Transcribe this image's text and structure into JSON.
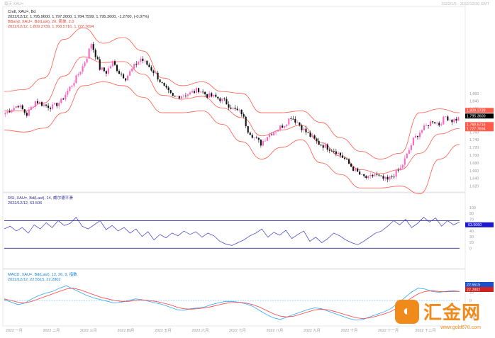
{
  "header": {
    "left": "每天 XAU=",
    "right": "2022/1/5 - 2022/12/30 GMT"
  },
  "brand": {
    "logo_text": "汇金网",
    "url": "www.gold678.com"
  },
  "colors": {
    "candle_up": "#ff66c4",
    "candle_down": "#111111",
    "bollinger": "#ff5a4a",
    "rsi_line": "#3a3acc",
    "rsi_bounds": "#2b2b99",
    "macd_line": "#2aa7ff",
    "signal_line": "#ff3d3d",
    "watermark": "#f08a1a"
  },
  "chart_data": [
    {
      "type": "candlestick",
      "legend": [
        "Cndl, XAU=, Bd",
        "2022/12/12, 1,795.9600, 1,797.2000, 1,784.7599, 1,795.3600, -1.2700, (-0.07%)",
        "BBand, XAU=, Bd(Last), 20, 简单, 2.0",
        "2022/12/12, 1,809.3739, 1,768.5716, 1,727.7694"
      ],
      "y_ticks": [
        "1,860",
        "1,840",
        "1,820",
        "1,800",
        "1,780",
        "1,760",
        "1,740",
        "1,720",
        "1,700",
        "1,680",
        "1,660",
        "1,640",
        "1,620"
      ],
      "ylim": [
        1610,
        2080
      ],
      "price_labels": [
        {
          "text": "1,809.3739",
          "value": 1809.37,
          "color": "#ff5a4a"
        },
        {
          "text": "1,795.3600",
          "value": 1795.36,
          "color": "#000000"
        },
        {
          "text": "1,768.5716",
          "value": 1768.57,
          "color": "#ff5a4a"
        },
        {
          "text": "1,727.7694",
          "value": 1727.77,
          "color": "#ff5a4a"
        }
      ],
      "close_path": [
        [
          0,
          1810
        ],
        [
          6,
          1830
        ],
        [
          10,
          1805
        ],
        [
          14,
          1840
        ],
        [
          18,
          1830
        ],
        [
          22,
          1825
        ],
        [
          26,
          1840
        ],
        [
          30,
          1875
        ],
        [
          33,
          1900
        ],
        [
          36,
          1930
        ],
        [
          38,
          1955
        ],
        [
          40,
          1990
        ],
        [
          42,
          1960
        ],
        [
          44,
          1925
        ],
        [
          47,
          1915
        ],
        [
          50,
          1940
        ],
        [
          53,
          1915
        ],
        [
          56,
          1900
        ],
        [
          60,
          1930
        ],
        [
          63,
          1950
        ],
        [
          66,
          1935
        ],
        [
          70,
          1910
        ],
        [
          74,
          1875
        ],
        [
          78,
          1850
        ],
        [
          82,
          1855
        ],
        [
          86,
          1860
        ],
        [
          90,
          1870
        ],
        [
          94,
          1855
        ],
        [
          98,
          1850
        ],
        [
          102,
          1840
        ],
        [
          106,
          1820
        ],
        [
          110,
          1810
        ],
        [
          113,
          1765
        ],
        [
          116,
          1745
        ],
        [
          119,
          1730
        ],
        [
          122,
          1750
        ],
        [
          126,
          1765
        ],
        [
          130,
          1780
        ],
        [
          133,
          1800
        ],
        [
          136,
          1785
        ],
        [
          139,
          1765
        ],
        [
          142,
          1750
        ],
        [
          146,
          1730
        ],
        [
          150,
          1720
        ],
        [
          154,
          1710
        ],
        [
          158,
          1690
        ],
        [
          162,
          1665
        ],
        [
          166,
          1645
        ],
        [
          169,
          1640
        ],
        [
          172,
          1650
        ],
        [
          175,
          1640
        ],
        [
          178,
          1635
        ],
        [
          181,
          1650
        ],
        [
          184,
          1665
        ],
        [
          187,
          1700
        ],
        [
          190,
          1740
        ],
        [
          193,
          1760
        ],
        [
          196,
          1775
        ],
        [
          199,
          1790
        ],
        [
          202,
          1780
        ],
        [
          205,
          1800
        ],
        [
          208,
          1790
        ],
        [
          211,
          1795
        ]
      ],
      "n_candles": 212,
      "bands_path": [
        {
          "upper": 1865,
          "lower": 1765
        },
        {
          "upper": 1870,
          "lower": 1760
        },
        {
          "upper": 1900,
          "lower": 1770
        },
        {
          "upper": 2000,
          "lower": 1810
        },
        {
          "upper": 2030,
          "lower": 1880
        },
        {
          "upper": 1990,
          "lower": 1890
        },
        {
          "upper": 2005,
          "lower": 1880
        },
        {
          "upper": 1970,
          "lower": 1850
        },
        {
          "upper": 1900,
          "lower": 1810
        },
        {
          "upper": 1880,
          "lower": 1810
        },
        {
          "upper": 1890,
          "lower": 1815
        },
        {
          "upper": 1865,
          "lower": 1780
        },
        {
          "upper": 1860,
          "lower": 1735
        },
        {
          "upper": 1810,
          "lower": 1690
        },
        {
          "upper": 1810,
          "lower": 1720
        },
        {
          "upper": 1815,
          "lower": 1740
        },
        {
          "upper": 1785,
          "lower": 1680
        },
        {
          "upper": 1745,
          "lower": 1650
        },
        {
          "upper": 1710,
          "lower": 1615
        },
        {
          "upper": 1690,
          "lower": 1615
        },
        {
          "upper": 1705,
          "lower": 1620
        },
        {
          "upper": 1810,
          "lower": 1600
        },
        {
          "upper": 1820,
          "lower": 1690
        },
        {
          "upper": 1810,
          "lower": 1728
        }
      ]
    },
    {
      "type": "line",
      "legend": [
        "RSI, XAU=, Bd(Last), 14, 威尔德平滑",
        "2022/12/12, 63.506"
      ],
      "y_ticks": [
        "100",
        "80",
        "70",
        "60",
        "40",
        "30",
        "20",
        "0"
      ],
      "ylim": [
        20,
        90
      ],
      "bounds": [
        70,
        30
      ],
      "last_label": {
        "text": "63.5060",
        "value": 63.5
      },
      "values": [
        58,
        62,
        55,
        60,
        52,
        64,
        58,
        67,
        60,
        70,
        63,
        66,
        75,
        62,
        58,
        64,
        70,
        57,
        63,
        55,
        60,
        52,
        58,
        47,
        54,
        42,
        50,
        45,
        52,
        48,
        55,
        50,
        54,
        46,
        52,
        48,
        40,
        36,
        34,
        38,
        42,
        48,
        52,
        58,
        46,
        53,
        49,
        56,
        44,
        50,
        55,
        40,
        46,
        38,
        44,
        52,
        48,
        42,
        38,
        35,
        40,
        46,
        52,
        55,
        62,
        70,
        64,
        72,
        60,
        66,
        75,
        68,
        74,
        62,
        70,
        64,
        68
      ],
      "colors": [
        "#3a3acc"
      ]
    },
    {
      "type": "line",
      "legend": [
        "MACD, XAU=, Bd(Last), 12, 26, 9, 指数",
        "2022/12/12, 22.5515, 22.2802"
      ],
      "y_ticks": [
        "20",
        "0",
        "-20",
        "-40"
      ],
      "ylim": [
        -55,
        45
      ],
      "zero_line": 0,
      "last_labels": [
        {
          "text": "22.5515",
          "value": 22.55,
          "color": "#2aa7ff"
        },
        {
          "text": "22.2802",
          "value": 22.28,
          "color": "#ff3d3d"
        }
      ],
      "series": [
        {
          "values": [
            2,
            -4,
            -10,
            -6,
            4,
            12,
            18,
            22,
            30,
            36,
            28,
            20,
            12,
            6,
            2,
            -2,
            -6,
            -4,
            0,
            4,
            2,
            -2,
            -6,
            -10,
            -16,
            -22,
            -24,
            -20,
            -18,
            -16,
            -10,
            -6,
            -2,
            -2,
            -4,
            -8,
            -14,
            -24,
            -34,
            -42,
            -46,
            -40,
            -34,
            -28,
            -22,
            -18,
            -20,
            -26,
            -32,
            -38,
            -44,
            -48,
            -46,
            -40,
            -34,
            -28,
            -20,
            -8,
            6,
            20,
            30,
            28,
            22,
            20,
            22,
            24,
            22
          ],
          "color": "#2aa7ff"
        },
        {
          "values": [
            4,
            0,
            -4,
            -6,
            -2,
            4,
            10,
            16,
            22,
            28,
            30,
            26,
            20,
            14,
            8,
            4,
            0,
            -2,
            -2,
            0,
            1,
            0,
            -2,
            -6,
            -10,
            -16,
            -20,
            -21,
            -20,
            -18,
            -15,
            -11,
            -7,
            -5,
            -4,
            -6,
            -10,
            -16,
            -24,
            -32,
            -38,
            -40,
            -38,
            -33,
            -28,
            -23,
            -21,
            -23,
            -27,
            -32,
            -37,
            -42,
            -44,
            -42,
            -38,
            -33,
            -27,
            -18,
            -6,
            6,
            16,
            22,
            24,
            22,
            21,
            22,
            22
          ],
          "color": "#ff3d3d"
        }
      ]
    }
  ],
  "x_ticks": [
    "2022 一月",
    "2022 二月",
    "2022 三月",
    "2022 四月",
    "2022 五月",
    "2022 六月",
    "2022 七月",
    "2022 八月",
    "2022 九月",
    "2022 十月",
    "2022 十一月",
    "2022 十二月"
  ]
}
